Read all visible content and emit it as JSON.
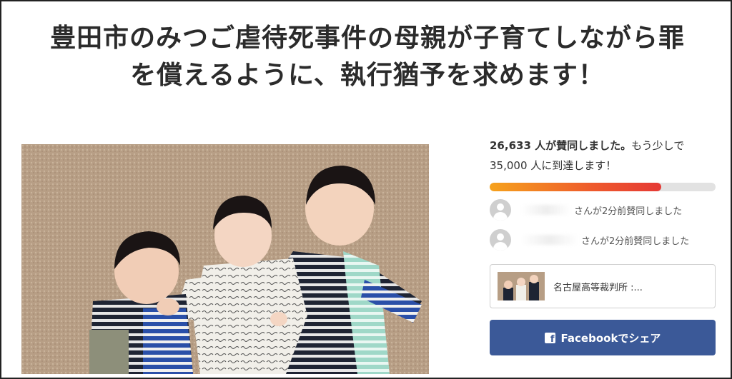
{
  "petition": {
    "title_line1": "豊田市のみつご虐待死事件の母親が子育てしながら罪",
    "title_line2": "を償えるように、執行猶予を求めます！"
  },
  "stats": {
    "signed_count": "26,633 人が賛同しました。",
    "more_text": "もう少しで",
    "goal_text": "35,000 人に到達します！",
    "progress_fraction": 0.76,
    "progress_color_start": "#f6a21c",
    "progress_color_end": "#e53935"
  },
  "recent_signers": [
    {
      "text": "さんが2分前賛同しました"
    },
    {
      "text": "さんが2分前賛同しました"
    }
  ],
  "decision_maker": {
    "label": "名古屋高等裁判所 :..."
  },
  "share": {
    "facebook_label": "Facebookでシェア",
    "facebook_icon": "f",
    "facebook_color": "#3b5998"
  }
}
